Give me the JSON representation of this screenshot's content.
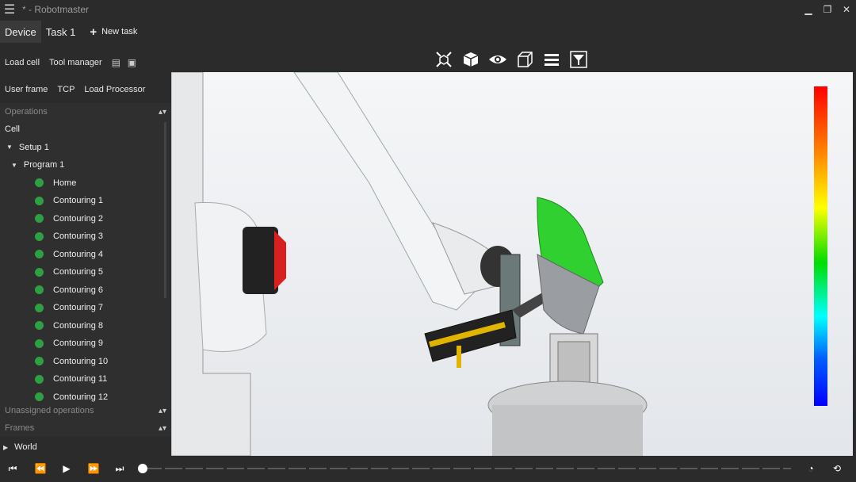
{
  "window": {
    "title": "* - Robotmaster"
  },
  "tabs": {
    "device": "Device",
    "task1": "Task 1",
    "new_task": "New task"
  },
  "toolbar": {
    "load_cell": "Load cell",
    "tool_manager": "Tool manager",
    "user_frame": "User frame",
    "tcp": "TCP",
    "load_processor": "Load Processor"
  },
  "operations": {
    "header": "Operations",
    "cell": "Cell",
    "setup": "Setup 1",
    "program": "Program 1",
    "items": [
      "Home",
      "Contouring 1",
      "Contouring 2",
      "Contouring 3",
      "Contouring 4",
      "Contouring 5",
      "Contouring 6",
      "Contouring 7",
      "Contouring 8",
      "Contouring 9",
      "Contouring 10",
      "Contouring 11",
      "Contouring 12"
    ]
  },
  "unassigned": "Unassigned operations",
  "frames": "Frames",
  "world": "World",
  "colors": {
    "status_ok": "#2ea043"
  }
}
